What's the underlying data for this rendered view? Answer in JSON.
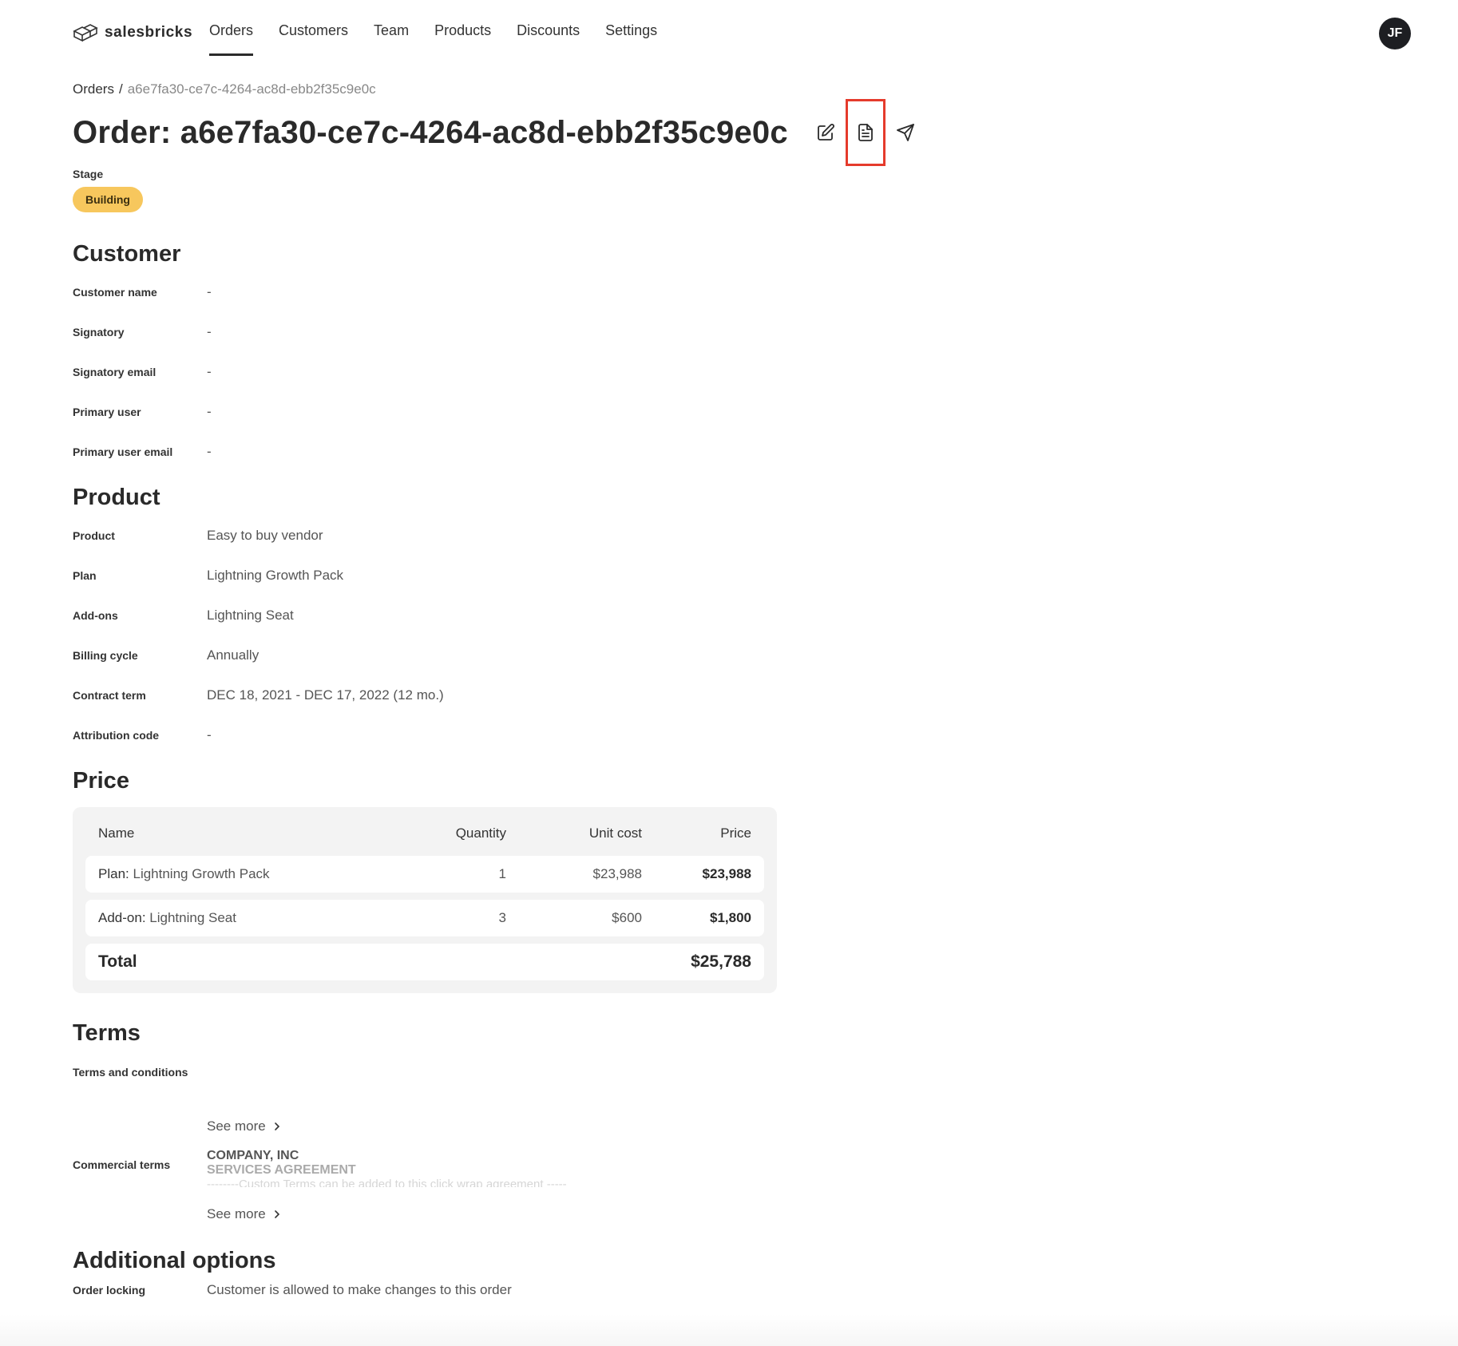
{
  "brand": {
    "name": "salesbricks"
  },
  "nav": {
    "links": [
      {
        "label": "Orders",
        "active": true
      },
      {
        "label": "Customers",
        "active": false
      },
      {
        "label": "Team",
        "active": false
      },
      {
        "label": "Products",
        "active": false
      },
      {
        "label": "Discounts",
        "active": false
      },
      {
        "label": "Settings",
        "active": false
      }
    ],
    "avatar_initials": "JF"
  },
  "breadcrumb": {
    "root": "Orders",
    "separator": "/",
    "current": "a6e7fa30-ce7c-4264-ac8d-ebb2f35c9e0c"
  },
  "page": {
    "title": "Order: a6e7fa30-ce7c-4264-ac8d-ebb2f35c9e0c",
    "actions": [
      "edit-icon",
      "document-icon",
      "send-icon"
    ],
    "highlight_color": "#e53b2c"
  },
  "stage": {
    "label": "Stage",
    "value": "Building",
    "color": "#f7c75d"
  },
  "customer": {
    "title": "Customer",
    "fields": [
      {
        "label": "Customer name",
        "value": "-"
      },
      {
        "label": "Signatory",
        "value": "-"
      },
      {
        "label": "Signatory email",
        "value": "-"
      },
      {
        "label": "Primary user",
        "value": "-"
      },
      {
        "label": "Primary user email",
        "value": "-"
      }
    ]
  },
  "product": {
    "title": "Product",
    "fields": [
      {
        "label": "Product",
        "value": "Easy to buy vendor"
      },
      {
        "label": "Plan",
        "value": "Lightning Growth Pack"
      },
      {
        "label": "Add-ons",
        "value": "Lightning Seat"
      },
      {
        "label": "Billing cycle",
        "value": "Annually"
      },
      {
        "label": "Contract term",
        "value": "DEC 18, 2021 - DEC 17, 2022 (12 mo.)"
      },
      {
        "label": "Attribution code",
        "value": "-"
      }
    ]
  },
  "price": {
    "title": "Price",
    "headers": {
      "name": "Name",
      "quantity": "Quantity",
      "unit_cost": "Unit cost",
      "price": "Price"
    },
    "rows": [
      {
        "type": "Plan:",
        "name": "Lightning Growth Pack",
        "quantity": "1",
        "unit_cost": "$23,988",
        "price": "$23,988"
      },
      {
        "type": "Add-on:",
        "name": "Lightning Seat",
        "quantity": "3",
        "unit_cost": "$600",
        "price": "$1,800"
      }
    ],
    "total_label": "Total",
    "total_value": "$25,788"
  },
  "terms": {
    "title": "Terms",
    "tc_label": "Terms and conditions",
    "see_more": "See more",
    "commercial_label": "Commercial terms",
    "company": "COMPANY, INC",
    "agreement": "SERVICES AGREEMENT",
    "faded_line": "--------Custom Terms can be added to this click wrap agreement -----"
  },
  "additional": {
    "title": "Additional options",
    "order_locking_label": "Order locking",
    "order_locking_value": "Customer is allowed to make changes to this order"
  }
}
